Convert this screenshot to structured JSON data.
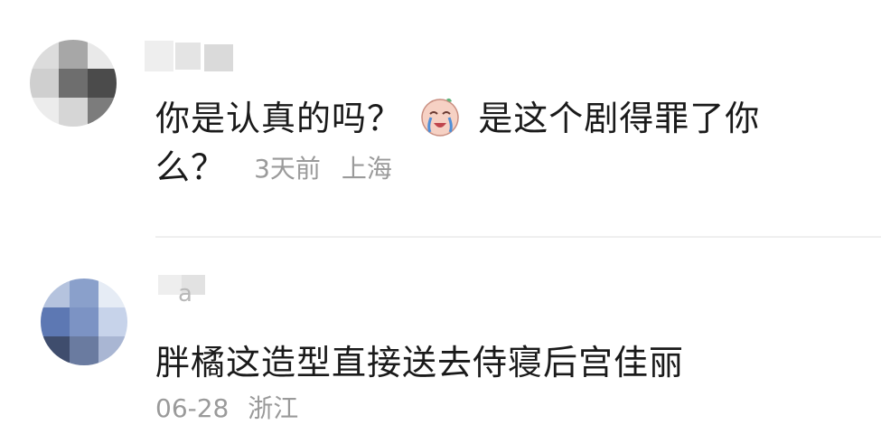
{
  "comments": [
    {
      "text_before": "你是认真的吗？",
      "text_after": "是这个剧得罪了你么？",
      "emoji": "crying-laughing-baby-emoji",
      "time": "3天前",
      "location": "上海"
    },
    {
      "username": "a",
      "text": "胖橘这造型直接送去侍寝后宫佳丽",
      "time": "06-28",
      "location": "浙江"
    }
  ],
  "colors": {
    "text": "#1a1a1a",
    "meta": "#9a9a9a",
    "divider": "#efefef"
  }
}
